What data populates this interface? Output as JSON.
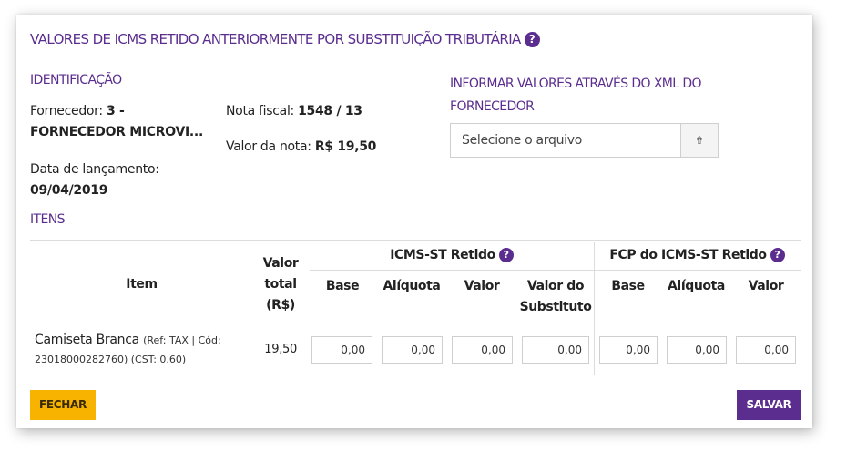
{
  "title": "VALORES DE ICMS RETIDO ANTERIORMENTE POR SUBSTITUIÇÃO TRIBUTÁRIA",
  "help_glyph": "?",
  "identification": {
    "label": "IDENTIFICAÇÃO",
    "supplier_label": "Fornecedor:",
    "supplier_value_line1": "3 -",
    "supplier_value_line2": "FORNECEDOR MICROVI...",
    "invoice_label": "Nota fiscal:",
    "invoice_value": "1548 / 13",
    "date_label": "Data de lançamento:",
    "date_value": "09/04/2019",
    "amount_label": "Valor da nota:",
    "amount_value": "R$ 19,50"
  },
  "xml": {
    "label_line1": "INFORMAR VALORES ATRAVÉS DO XML DO",
    "label_line2": "FORNECEDOR",
    "placeholder": "Selecione o arquivo",
    "upload_glyph": "⇮"
  },
  "items": {
    "label": "ITENS",
    "headers": {
      "item": "Item",
      "total_line1": "Valor",
      "total_line2": "total",
      "total_line3": "(R$)",
      "icms_group": "ICMS-ST Retido",
      "fcp_group": "FCP do ICMS-ST Retido",
      "base": "Base",
      "aliquota": "Alíquota",
      "valor": "Valor",
      "substituto_line1": "Valor do",
      "substituto_line2": "Substituto",
      "fcp_base": "Base",
      "fcp_aliquota": "Alíquota",
      "fcp_valor": "Valor"
    },
    "rows": [
      {
        "name": "Camiseta Branca",
        "ref_line1": "(Ref: TAX | Cód:",
        "ref_line2": "23018000282760) (CST: 0.60)",
        "total": "19,50",
        "icms_base": "0,00",
        "icms_aliquota": "0,00",
        "icms_valor": "0,00",
        "icms_substituto": "0,00",
        "fcp_base": "0,00",
        "fcp_aliquota": "0,00",
        "fcp_valor": "0,00"
      }
    ]
  },
  "buttons": {
    "close": "FECHAR",
    "save": "SALVAR"
  },
  "colors": {
    "accent": "#5b2d8e",
    "close_button": "#f7b300"
  }
}
